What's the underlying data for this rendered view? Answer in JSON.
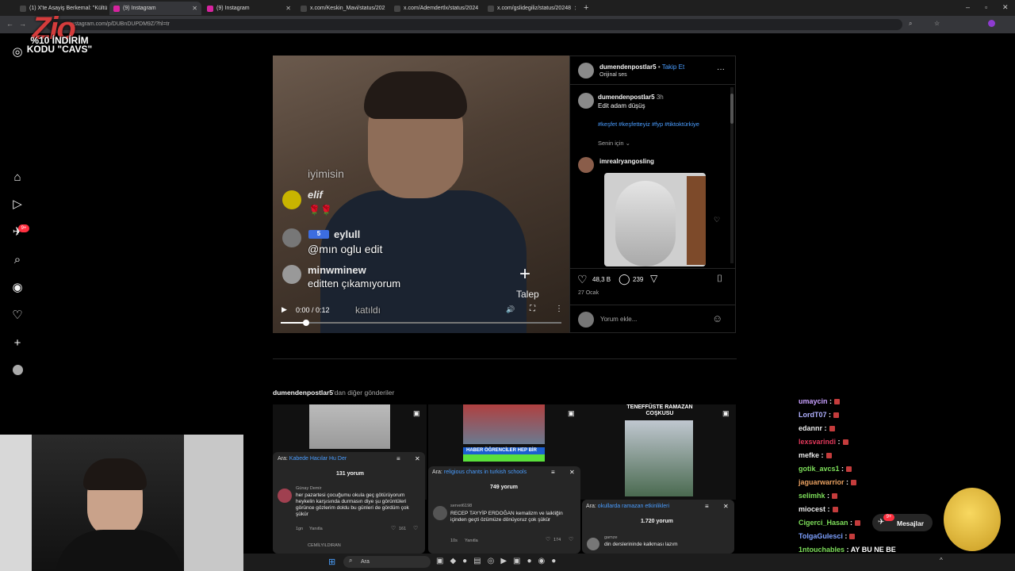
{
  "browser": {
    "tabs": [
      {
        "title": "(1) X'te Asayiş Berkemal: \"Kültü",
        "favicon": "x"
      },
      {
        "title": "(9) Instagram",
        "favicon": "instagram"
      },
      {
        "title": "(9) Instagram",
        "favicon": "instagram"
      },
      {
        "title": "x.com/Keskin_Mavi/status/202",
        "favicon": "x"
      },
      {
        "title": "x.com/Ademdertlx/status/2024",
        "favicon": "x"
      },
      {
        "title": "x.com/gslidegiliz/status/20248",
        "favicon": "x"
      }
    ],
    "url": "instagram.com/p/DUBnDUPDM9Z/?hl=tr"
  },
  "overlay": {
    "logo": "Zio",
    "promo": "%10 İNDİRİM KODU \"CAVS\""
  },
  "post": {
    "author": "dumendenpostlar5",
    "follow_sep": "•",
    "follow_label": "Takip Et",
    "audio": "Orijinal ses",
    "more": "···",
    "caption_author": "dumendenpostlar5",
    "caption_time": "3h",
    "caption_text": "Edit adam düşüş",
    "hashtags": "#keşfet #keşfetteyiz #fyp #tiktoktürkiye",
    "for_you": "Senin için",
    "comment_author": "imrealryangosling",
    "likes": "48,3 B",
    "comments": "239",
    "date": "27 Ocak",
    "comment_placeholder": "Yorum ekle...",
    "video": {
      "overlay_lines": [
        "iyimisin",
        "elif",
        "eylull",
        "@mın oglu edit",
        "minwminew",
        "editten çıkamıyorum",
        "katıldı"
      ],
      "badge": "5",
      "talep": "Talep",
      "time": "0:00 / 0:12",
      "progress": 0.09
    }
  },
  "more_posts": {
    "heading_author": "dumendenpostlar5",
    "heading_rest": "'dan diğer gönderiler",
    "thumb3_title": "TENEFFÜSTE RAMAZAN COŞKUSU",
    "thumb2_text": "HABER ÖĞRENCİLER HEP BİR"
  },
  "popups": [
    {
      "search_label": "Ara:",
      "search": "Kabede Hacılar Hu Der",
      "count": "131 yorum",
      "user": "Günay Demir",
      "text": "her pazartesi çocuğumu okula geç götürüyorum heykelin karşısında durmasın diye şu görüntüleri görünce gözlerim doldu bu günleri de gördüm çok şükür",
      "time": "1gn",
      "reply": "Yanıtla",
      "likes": "161",
      "next_user": "CEMİLYILDIRAN"
    },
    {
      "search_label": "Ara:",
      "search": "religious chants in turkish schools",
      "count": "749 yorum",
      "user": "servet6198",
      "text": "RECEP TAYYİP ERDOĞAN kemalizm ve laikliğin içinden geçti özümüze dönüyoruz çok şükür",
      "time": "10s",
      "reply": "Yanıtla",
      "likes": "174"
    },
    {
      "search_label": "Ara:",
      "search": "okullarda ramazan etkinlikleri",
      "count": "1.720 yorum",
      "user": "gamze",
      "text": "din derslerininde kalkması lazım"
    }
  ],
  "chat": [
    {
      "user": "umaycin",
      "color": "#c8a0ff"
    },
    {
      "user": "LordT07",
      "color": "#b0b0ff"
    },
    {
      "user": "edannr",
      "color": "#e8e8e8"
    },
    {
      "user": "lexsvarindi",
      "color": "#e0385a"
    },
    {
      "user": "mefke",
      "color": "#e8e8e8"
    },
    {
      "user": "gotik_avcs1",
      "color": "#7dde5a"
    },
    {
      "user": "jaguarwarrior",
      "color": "#e8a060"
    },
    {
      "user": "selimhk",
      "color": "#7dde5a"
    },
    {
      "user": "miocest",
      "color": "#e8e8e8"
    },
    {
      "user": "Cigerci_Hasan",
      "color": "#7dde5a"
    },
    {
      "user": "TolgaGulesci",
      "color": "#7da0ff"
    },
    {
      "user": "1ntouchables",
      "color": "#7dde5a",
      "message": "AY BU NE BE"
    }
  ],
  "chat_sep": ":",
  "messages_button": {
    "label": "Mesajlar",
    "badge": "9+"
  },
  "nav_badge": "9+",
  "taskbar": {
    "search": "Ara"
  }
}
